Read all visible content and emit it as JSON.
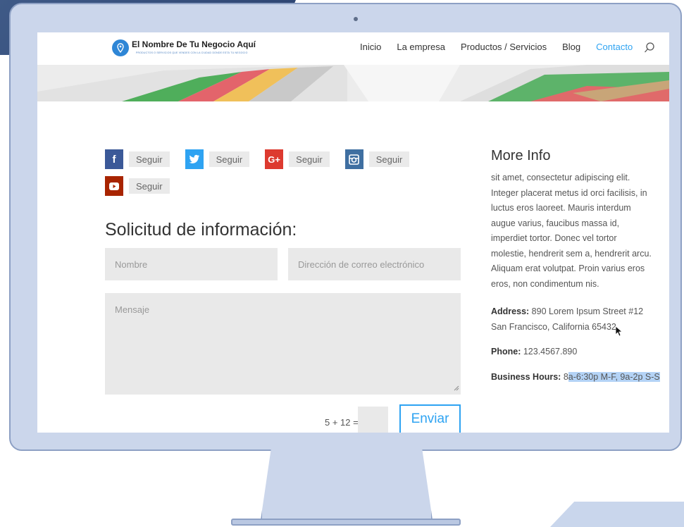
{
  "header": {
    "logo_title": "El Nombre De Tu Negocio Aquí",
    "logo_tagline": "PRODUCTOS O SERVICIOS QUE VENDES CON LA CIUDAD DONDE ESTÁ TU NEGOCIO",
    "nav": [
      "Inicio",
      "La empresa",
      "Productos / Servicios",
      "Blog",
      "Contacto"
    ],
    "active_nav": "Contacto"
  },
  "social": {
    "follow_label": "Seguir",
    "networks": [
      {
        "name": "facebook-icon",
        "glyph": "f",
        "color": "#3b5998"
      },
      {
        "name": "twitter-icon",
        "glyph": "",
        "color": "#2ea3f2"
      },
      {
        "name": "google-plus-icon",
        "glyph": "G+",
        "color": "#dd3a2f"
      },
      {
        "name": "instagram-icon",
        "glyph": "",
        "color": "#3f6fa1"
      },
      {
        "name": "youtube-icon",
        "glyph": "",
        "color": "#a82400"
      }
    ]
  },
  "form": {
    "title": "Solicitud de información:",
    "name_placeholder": "Nombre",
    "email_placeholder": "Dirección de correo electrónico",
    "message_placeholder": "Mensaje",
    "captcha": "5 + 12 =",
    "submit": "Enviar"
  },
  "sidebar": {
    "title": "More Info",
    "body": "sit amet, consectetur adipiscing elit. Integer placerat metus id orci facilisis, in luctus eros laoreet. Mauris interdum augue varius, faucibus massa id, imperdiet tortor. Donec vel tortor molestie, hendrerit sem a, hendrerit arcu. Aliquam erat volutpat. Proin varius eros eros, non condimentum nis.",
    "address_label": "Address:",
    "address_value": "890 Lorem Ipsum Street #12 San Francisco, California 65432",
    "phone_label": "Phone:",
    "phone_value": "123.4567.890",
    "hours_label": "Business Hours:",
    "hours_value_plain": "8",
    "hours_value_selected": "a-6:30p M-F, 9a-2p S-S"
  },
  "colors": {
    "accent": "#2ea3f2",
    "field_bg": "#e9e9e9",
    "monitor_frame": "#cbd6eb"
  }
}
